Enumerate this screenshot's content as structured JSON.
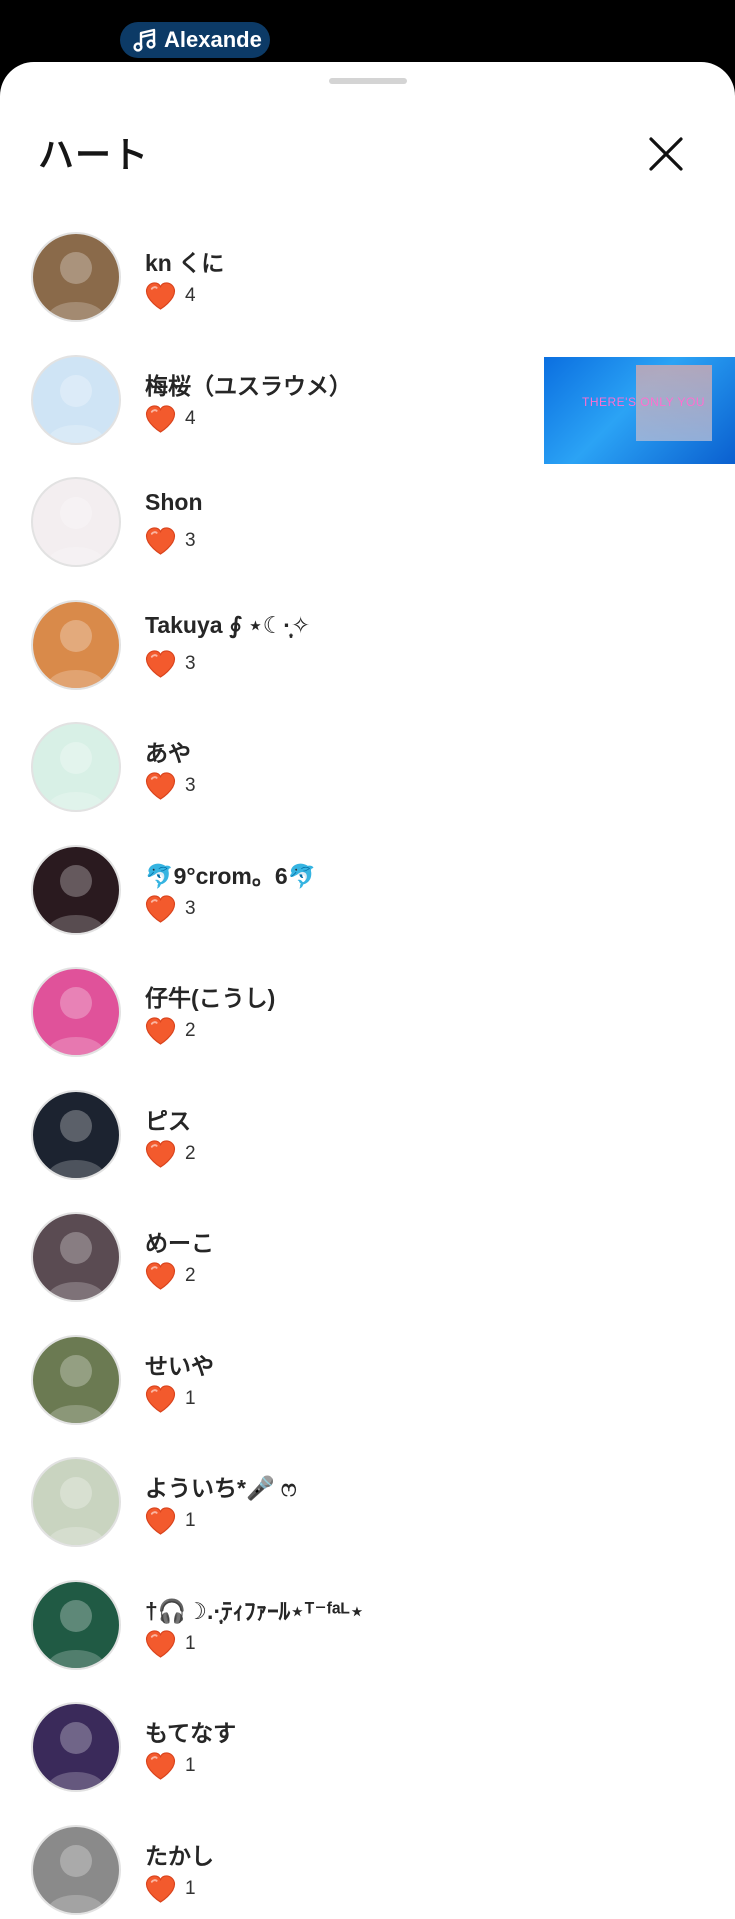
{
  "status_bar": {
    "music_label": "Alexande"
  },
  "sheet": {
    "title": "ハート",
    "close_icon": "close-icon"
  },
  "video_overlay": {
    "text": "THERE'S ONLY YOU"
  },
  "hearts_list": [
    {
      "name": "kn くに",
      "count": "4",
      "avatar_bg": "#8a6a4a"
    },
    {
      "name": "梅桜（ユスラウメ）",
      "count": "4",
      "avatar_bg": "#cfe4f5"
    },
    {
      "name": "Shon",
      "count": "3",
      "avatar_bg": "#f3eef0"
    },
    {
      "name": "Takuya ∮ ⋆☾·̩͙✧",
      "count": "3",
      "avatar_bg": "#d98a4a"
    },
    {
      "name": "あや",
      "count": "3",
      "avatar_bg": "#d8f0e6"
    },
    {
      "name": "🐬9°crom。6🐬",
      "count": "3",
      "avatar_bg": "#2a1a1f"
    },
    {
      "name": "仔牛(こうし)",
      "count": "2",
      "avatar_bg": "#e0529a"
    },
    {
      "name": "ピス",
      "count": "2",
      "avatar_bg": "#1c2330"
    },
    {
      "name": "めーこ",
      "count": "2",
      "avatar_bg": "#5a4b52"
    },
    {
      "name": "せいや",
      "count": "1",
      "avatar_bg": "#6b7a52"
    },
    {
      "name": "よういち*🎤 ෆ",
      "count": "1",
      "avatar_bg": "#c9d4c0"
    },
    {
      "name": "†🎧☽.·̩͙ﾃｨﾌｧｰﾙ⋆ᵀ⁻ᶠᵃᴸ⋆",
      "count": "1",
      "avatar_bg": "#205a44"
    },
    {
      "name": "もてなす",
      "count": "1",
      "avatar_bg": "#3a2a5a"
    },
    {
      "name": "たかし",
      "count": "1",
      "avatar_bg": "#8a8a8a"
    }
  ],
  "colors": {
    "heart": "#f35a2d",
    "heart_dark": "#d9431c",
    "pill": "#0c3a66"
  }
}
